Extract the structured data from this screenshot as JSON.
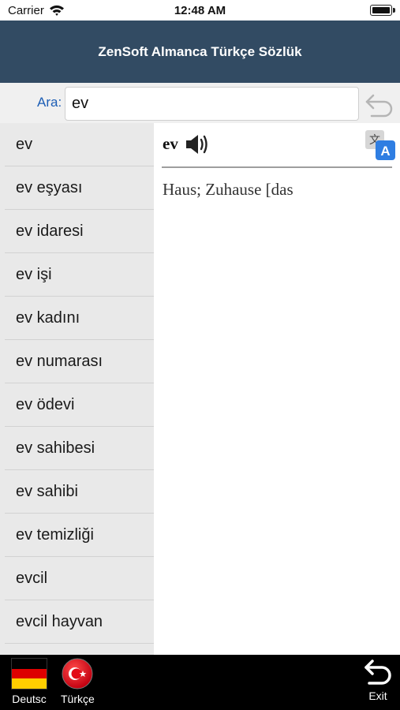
{
  "status_bar": {
    "carrier": "Carrier",
    "time": "12:48 AM"
  },
  "nav": {
    "title": "ZenSoft Almanca Türkçe Sözlük"
  },
  "search": {
    "label": "Ara:",
    "value": "ev"
  },
  "words": [
    "ev",
    "ev eşyası",
    "ev idaresi",
    "ev işi",
    "ev kadını",
    "ev numarası",
    "ev ödevi",
    "ev sahibesi",
    "ev sahibi",
    "ev temizliği",
    "evcil",
    "evcil hayvan"
  ],
  "detail": {
    "headword": "ev",
    "meaning": "Haus; Zuhause [das"
  },
  "tabs": {
    "german": "Deutsc",
    "turkish": "Türkçe",
    "exit": "Exit"
  },
  "icons": {
    "wifi": "wifi-icon",
    "battery": "battery-icon",
    "undo": "undo-icon",
    "speaker": "speaker-icon",
    "translate": "translate-icon",
    "german_flag": "german-flag-icon",
    "turkish_flag": "turkish-flag-icon",
    "exit": "exit-icon"
  },
  "colors": {
    "nav_background": "#324b63",
    "search_label": "#1d5eb5",
    "list_background": "#e9e9e9",
    "tab_bar_background": "#000000",
    "german_flag": [
      "#000000",
      "#dd0000",
      "#ffce00"
    ],
    "turkish_flag": "#e30a17"
  }
}
